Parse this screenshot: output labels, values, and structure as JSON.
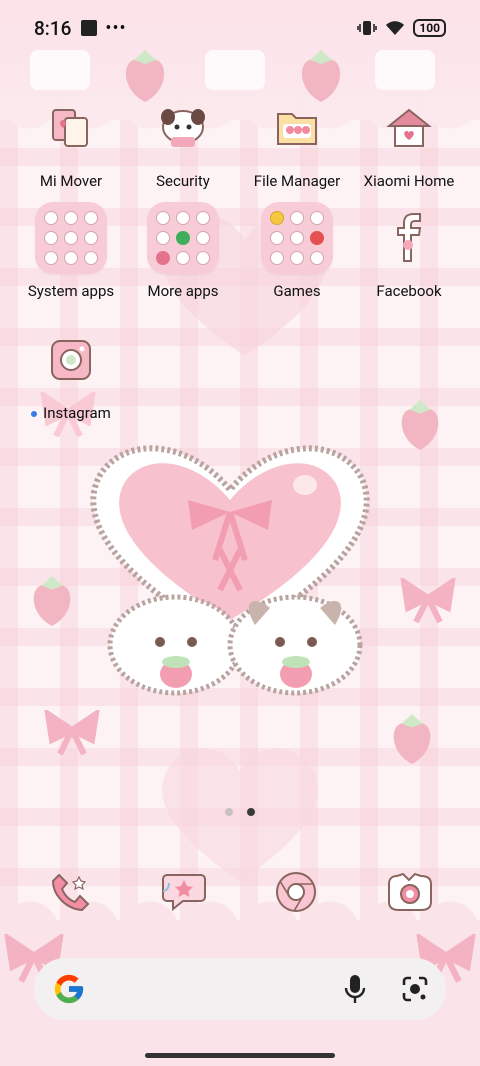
{
  "status_bar": {
    "time": "8:16",
    "battery": "100"
  },
  "apps_row1": [
    {
      "label": "Mi Mover",
      "icon": "mi-mover-icon"
    },
    {
      "label": "Security",
      "icon": "security-icon"
    },
    {
      "label": "File Manager",
      "icon": "file-manager-icon"
    },
    {
      "label": "Xiaomi Home",
      "icon": "xiaomi-home-icon"
    }
  ],
  "apps_row2": [
    {
      "label": "System apps",
      "icon": "folder-icon"
    },
    {
      "label": "More apps",
      "icon": "folder-icon"
    },
    {
      "label": "Games",
      "icon": "folder-icon"
    },
    {
      "label": "Facebook",
      "icon": "facebook-icon"
    }
  ],
  "apps_row3": [
    {
      "label": "Instagram",
      "icon": "instagram-icon"
    }
  ],
  "dock": [
    {
      "icon": "phone-icon"
    },
    {
      "icon": "messages-icon"
    },
    {
      "icon": "chrome-icon"
    },
    {
      "icon": "camera-icon"
    }
  ],
  "search": {
    "left_icon": "google-icon",
    "right_icons": [
      "microphone-icon",
      "lens-icon"
    ]
  },
  "pager": {
    "pages": 2,
    "current": 2
  },
  "colors": {
    "accent_pink": "#f7ccd6",
    "deep_pink": "#e58ea3",
    "page_dot_active": "#3a3a3a",
    "new_dot": "#3a7bea"
  }
}
